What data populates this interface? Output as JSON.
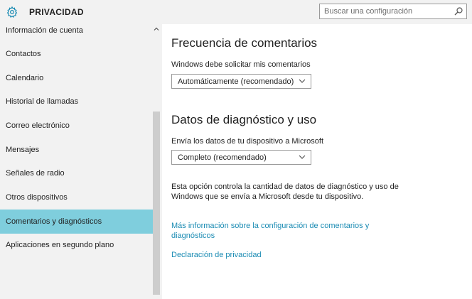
{
  "header": {
    "icon": "gear-icon",
    "title": "PRIVACIDAD",
    "search": {
      "placeholder": "Buscar una configuración",
      "value": "",
      "icon": "search-icon"
    }
  },
  "sidebar": {
    "items": [
      {
        "label": "Información de cuenta"
      },
      {
        "label": "Contactos"
      },
      {
        "label": "Calendario"
      },
      {
        "label": "Historial de llamadas"
      },
      {
        "label": "Correo electrónico"
      },
      {
        "label": "Mensajes"
      },
      {
        "label": "Señales de radio"
      },
      {
        "label": "Otros dispositivos"
      },
      {
        "label": "Comentarios y diagnósticos",
        "selected": true
      },
      {
        "label": "Aplicaciones en segundo plano"
      }
    ],
    "selected_color": "#7fcedd"
  },
  "main": {
    "feedback": {
      "heading": "Frecuencia de comentarios",
      "label": "Windows debe solicitar mis comentarios",
      "dropdown_value": "Automáticamente (recomendado)"
    },
    "diagnostics": {
      "heading": "Datos de diagnóstico y uso",
      "label": "Envía los datos de tu dispositivo a Microsoft",
      "dropdown_value": "Completo (recomendado)",
      "description": "Esta opción controla la cantidad de datos de diagnóstico y uso de Windows que se envía a Microsoft desde tu dispositivo."
    },
    "links": {
      "more_info": "Más información sobre la configuración de comentarios y diagnósticos",
      "privacy": "Declaración de privacidad"
    },
    "link_color": "#1a8bb3"
  }
}
